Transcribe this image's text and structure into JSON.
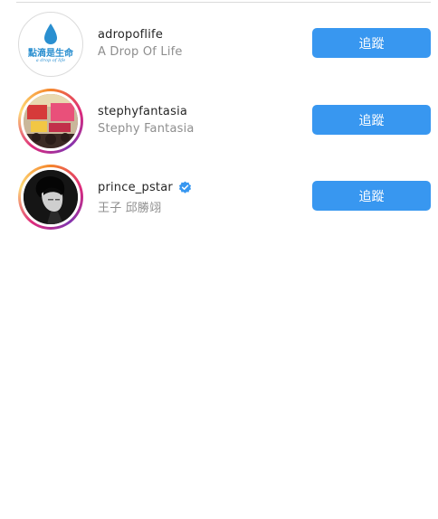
{
  "accent_color": "#3897f0",
  "verified_color": "#3897f0",
  "rows": [
    {
      "username": "adropoflife",
      "full_name": "A Drop Of Life",
      "button": "追蹤",
      "verified": false,
      "logo_text": "點滴是生命",
      "logo_subtext": "a drop of life",
      "avatar": "water-drop-logo"
    },
    {
      "username": "stephyfantasia",
      "full_name": "Stephy Fantasia",
      "button": "追蹤",
      "verified": false,
      "avatar": "collage-photo"
    },
    {
      "username": "prince_pstar",
      "full_name": "王子 邱勝翊",
      "button": "追蹤",
      "verified": true,
      "avatar": "portrait-photo"
    }
  ]
}
